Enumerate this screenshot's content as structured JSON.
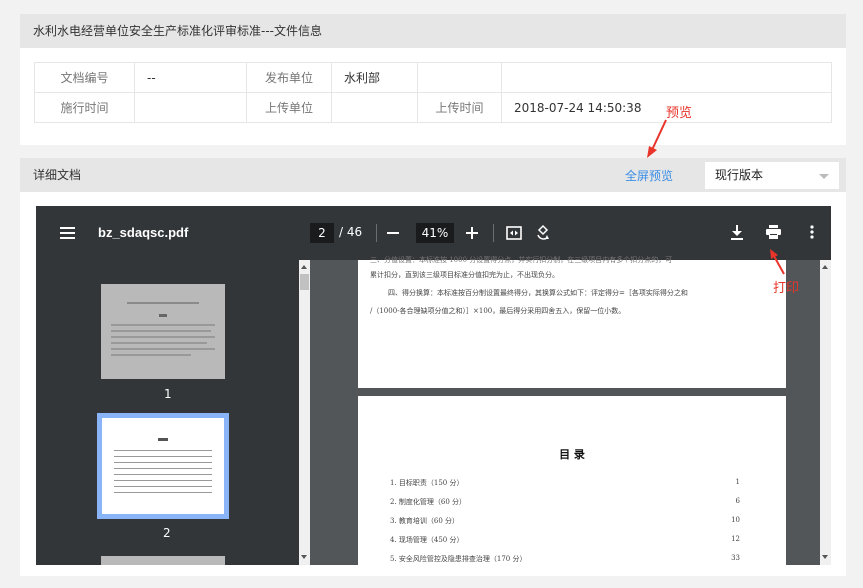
{
  "info_panel": {
    "title": "水利水电经营单位安全生产标准化评审标准---文件信息",
    "rows": [
      {
        "k1": "文档编号",
        "v1": "--",
        "k2": "发布单位",
        "v2": "水利部",
        "k3": "",
        "v3": ""
      },
      {
        "k1": "施行时间",
        "v1": "",
        "k2": "上传单位",
        "v2": "",
        "k3": "上传时间",
        "v3": "2018-07-24 14:50:38"
      }
    ]
  },
  "detail_panel": {
    "title": "详细文档",
    "fullscreen_label": "全屏预览",
    "version_value": "现行版本"
  },
  "annotations": {
    "preview": "预览",
    "print": "打印",
    "color": "#e8342a"
  },
  "viewer": {
    "file_name": "bz_sdaqsc.pdf",
    "current_page": "2",
    "total_pages": "/ 46",
    "zoom": "41%",
    "thumbnails": [
      {
        "number": "1"
      },
      {
        "number": "2"
      }
    ],
    "page1_lines": [
      "累计扣分，直到该三级项目标准分值扣完为止，不出现负分。",
      "四、得分换算：本标准按百分制设置最终得分，其换算公式如下：评定得分=［各项实际得分之和",
      "/（1000-各合理缺项分值之和）］×100，最后得分采用四舍五入，保留一位小数。"
    ],
    "toc_title": "目  录",
    "toc_items": [
      {
        "label": "1. 目标职责（150 分）",
        "page": "1"
      },
      {
        "label": "2. 制度化管理（60 分）",
        "page": "6"
      },
      {
        "label": "3. 教育培训（60 分）",
        "page": "10"
      },
      {
        "label": "4. 现场管理（450 分）",
        "page": "12"
      },
      {
        "label": "5. 安全风险管控及隐患排查治理（170 分）",
        "page": "33"
      }
    ]
  },
  "icons": {
    "menu": "menu-icon",
    "zoom_out": "minus-icon",
    "zoom_in": "plus-icon",
    "fit": "fit-page-icon",
    "rotate": "rotate-icon",
    "download": "download-icon",
    "print": "print-icon",
    "more": "more-vert-icon"
  }
}
